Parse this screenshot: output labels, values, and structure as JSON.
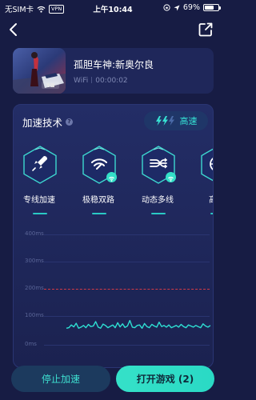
{
  "statusbar": {
    "carrier": "无SIM卡",
    "vpn": "VPN",
    "time": "上午10:44",
    "battery_text": "69%",
    "battery_level": 0.69
  },
  "game": {
    "title": "孤胆车神:新奥尔良",
    "network": "WiFi",
    "timer": "00:00:02"
  },
  "acceleration": {
    "title": "加速技术",
    "help": "?",
    "speed_label": "高速",
    "techniques": [
      {
        "label": "专线加速",
        "icon": "rocket-icon",
        "has_badge": false
      },
      {
        "label": "极稳双路",
        "icon": "dual-wifi-icon",
        "has_badge": true
      },
      {
        "label": "动态多线",
        "icon": "multi-line-icon",
        "has_badge": true
      },
      {
        "label": "高速",
        "icon": "globe-icon",
        "has_badge": false
      }
    ]
  },
  "latency_chart": {
    "y_ticks": [
      "400ms",
      "300ms",
      "200ms",
      "100ms",
      "0ms"
    ],
    "threshold_ms": 200,
    "accent_color": "#2ee0d3",
    "threshold_color": "#d33a46"
  },
  "chart_data": {
    "type": "line",
    "ylim": [
      0,
      400
    ],
    "series": [
      {
        "values": [
          60,
          62,
          72,
          65,
          78,
          60,
          64,
          70,
          62,
          74,
          66,
          68,
          84,
          64,
          60,
          75,
          70,
          62,
          67,
          72,
          62,
          80,
          65,
          76,
          63,
          68,
          88,
          64,
          62,
          70,
          72,
          60,
          77,
          66,
          62,
          74,
          68,
          64,
          82,
          66,
          70,
          64,
          72,
          62,
          66,
          70,
          64,
          74,
          66,
          62,
          72,
          68,
          64,
          70,
          66,
          62,
          76,
          68,
          64,
          70
        ]
      }
    ]
  },
  "actions": {
    "stop": "停止加速",
    "open": "打开游戏 (2)"
  }
}
